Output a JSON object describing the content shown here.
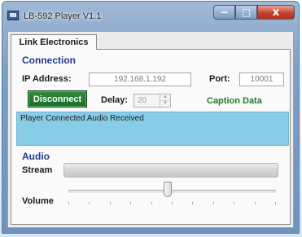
{
  "window": {
    "title": "LB-592 Player V1.1",
    "minimize_symbol": "−",
    "maximize_symbol": "□",
    "close_symbol": "x"
  },
  "tabs": [
    {
      "label": "Link Electronics",
      "active": true
    }
  ],
  "connection": {
    "heading": "Connection",
    "ip_label": "IP Address:",
    "ip_value": "192.168.1.192",
    "port_label": "Port:",
    "port_value": "10001",
    "disconnect_label": "Disconnect",
    "delay_label": "Delay:",
    "delay_value": "20",
    "caption_label": "Caption Data",
    "status_text": "Player Connected Audio Received"
  },
  "audio": {
    "heading": "Audio",
    "stream_label": "Stream",
    "volume_label": "Volume",
    "volume_level": 0.48,
    "tick_count": 11
  },
  "colors": {
    "status_background": "#87cde8",
    "disconnect_button": "#1b6e29",
    "caption_label": "#1e7b2d",
    "section_heading": "#1f3a8a"
  }
}
